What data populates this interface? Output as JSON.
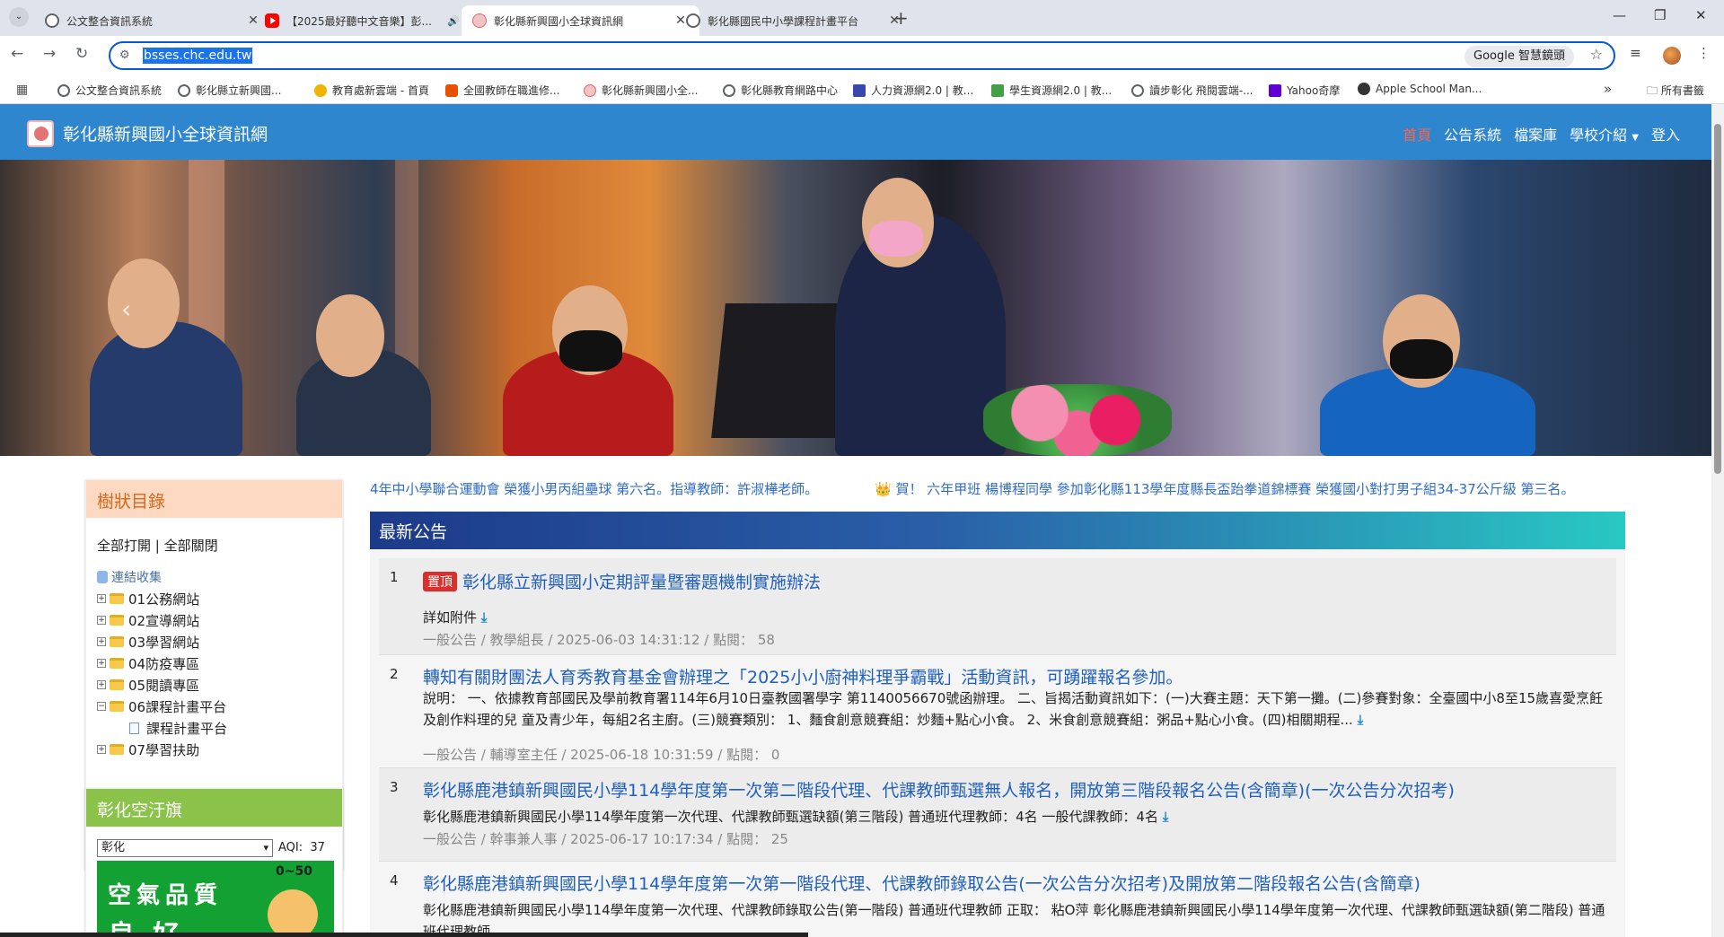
{
  "browser": {
    "tabs": [
      {
        "title": "公文整合資訊系統",
        "icon": "globe-icon",
        "active": false
      },
      {
        "title": "【2025最好聽中文音樂】彭...",
        "icon": "youtube-icon",
        "active": false,
        "audio": "speaker-icon"
      },
      {
        "title": "彰化縣新興國小全球資訊網",
        "icon": "school-favicon",
        "active": true
      },
      {
        "title": "彰化縣國民中小學課程計畫平台",
        "icon": "globe-icon",
        "active": false
      }
    ],
    "url": "bsses.chc.edu.tw",
    "lens_label": "Google 智慧鏡頭",
    "bookmarks": [
      {
        "label": "公文整合資訊系統",
        "color": "#5f6368"
      },
      {
        "label": "彰化縣立新興國...",
        "color": "#5f6368"
      },
      {
        "label": "教育處新雲端 - 首頁",
        "color": "#f0b400"
      },
      {
        "label": "全國教師在職進修...",
        "color": "#e65100"
      },
      {
        "label": "彰化縣新興國小全...",
        "color": "#e57373"
      },
      {
        "label": "彰化縣教育網路中心",
        "color": "#5f6368"
      },
      {
        "label": "人力資源網2.0 | 教...",
        "color": "#3949ab"
      },
      {
        "label": "學生資源網2.0 | 教...",
        "color": "#43a047"
      },
      {
        "label": "讀步彰化 飛閱雲端-...",
        "color": "#5f6368"
      },
      {
        "label": "Yahoo奇摩",
        "color": "#6001d2"
      },
      {
        "label": "Apple School Man...",
        "color": "#333333"
      }
    ],
    "all_bookmarks_label": "所有書籤"
  },
  "site": {
    "title": "彰化縣新興國小全球資訊網",
    "nav": [
      "首頁",
      "公告系統",
      "檔案庫",
      "學校介紹",
      "登入"
    ],
    "accent": "#2e86cf"
  },
  "tree_panel": {
    "heading": "樹狀目錄",
    "open_all": "全部打開",
    "separator": "|",
    "close_all": "全部關閉",
    "root": "連結收集",
    "nodes": [
      {
        "label": "01公務網站",
        "sign": "+"
      },
      {
        "label": "02宣導網站",
        "sign": "+"
      },
      {
        "label": "03學習網站",
        "sign": "+"
      },
      {
        "label": "04防疫專區",
        "sign": "+"
      },
      {
        "label": "05閱讀專區",
        "sign": "+"
      },
      {
        "label": "06課程計畫平台",
        "sign": "−"
      },
      {
        "label": "07學習扶助",
        "sign": "+"
      }
    ],
    "child": "課程計畫平台"
  },
  "aqi_panel": {
    "heading": "彰化空汙旗",
    "selected_city": "彰化",
    "aqi_label": "AQI:",
    "aqi_value": "37",
    "card_line1": "空氣品質",
    "card_line2": "良好",
    "card_range": "0~50"
  },
  "marquee": {
    "item1": "4年中小學聯合運動會 榮獲小男丙組壘球 第六名。指導教師：許淑樺老師。",
    "item2": "賀！ 六年甲班 楊博程同學 參加彰化縣113學年度縣長盃跆拳道錦標賽 榮獲國小對打男子組34-37公斤級 第三名。"
  },
  "news": {
    "heading": "最新公告",
    "items": [
      {
        "num": "1",
        "pinned": "置頂",
        "title": "彰化縣立新興國小定期評量暨審題機制實施辦法",
        "desc": "詳如附件",
        "meta": "一般公告 / 教學組長 / 2025-06-03 14:31:12 / 點閱： 58"
      },
      {
        "num": "2",
        "title": "轉知有關財團法人育秀教育基金會辦理之「2025小小廚神料理爭霸戰」活動資訊，可踴躍報名參加。",
        "desc": "說明： 一、依據教育部國民及學前教育署114年6月10日臺教國署學字 第1140056670號函辦理。 二、旨揭活動資訊如下：(一)大賽主題：天下第一攤。(二)參賽對象：全臺國中小8至15歲喜愛烹飪及創作料理的兒 童及青少年，每組2名主廚。(三)競賽類別： 1、麵食創意競賽組：炒麵+點心小食。 2、米食創意競賽組：粥品+點心小食。(四)相關期程...",
        "meta": "一般公告 / 輔導室主任 / 2025-06-18 10:31:59 / 點閱： 0"
      },
      {
        "num": "3",
        "title": "彰化縣鹿港鎮新興國民小學114學年度第一次第二階段代理、代課教師甄選無人報名，開放第三階段報名公告(含簡章)(一次公告分次招考)",
        "desc": "彰化縣鹿港鎮新興國民小學114學年度第一次代理、代課教師甄選缺額(第三階段) 普通班代理教師：4名 一般代課教師：4名",
        "meta": "一般公告 / 幹事兼人事 / 2025-06-17 10:17:34 / 點閱： 25"
      },
      {
        "num": "4",
        "title": "彰化縣鹿港鎮新興國民小學114學年度第一次第一階段代理、代課教師錄取公告(一次公告分次招考)及開放第二階段報名公告(含簡章)",
        "desc": "彰化縣鹿港鎮新興國民小學114學年度第一次代理、代課教師錄取公告(第一階段) 普通班代理教師 正取： 粘O萍 彰化縣鹿港鎮新興國民小學114學年度第一次代理、代課教師甄選缺額(第二階段) 普通班代理教師",
        "meta": ""
      }
    ]
  }
}
